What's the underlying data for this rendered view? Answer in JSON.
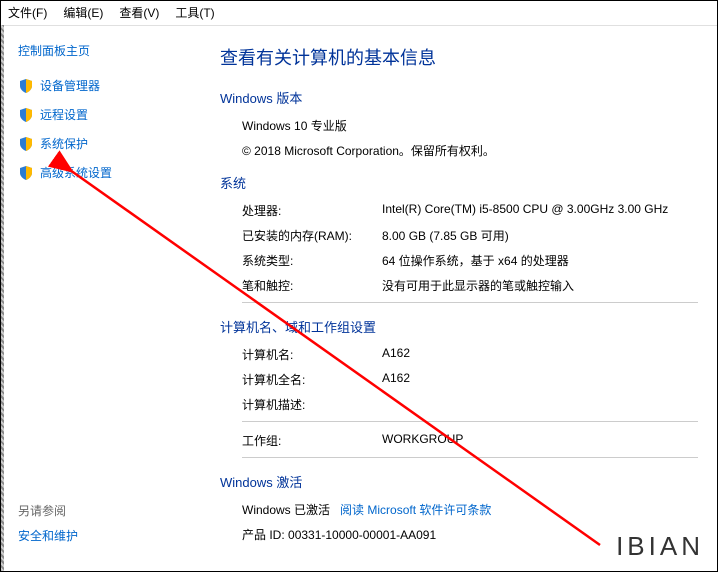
{
  "menu": {
    "file": "文件(F)",
    "edit": "编辑(E)",
    "view": "查看(V)",
    "tools": "工具(T)"
  },
  "sidebar": {
    "home": "控制面板主页",
    "items": [
      {
        "label": "设备管理器"
      },
      {
        "label": "远程设置"
      },
      {
        "label": "系统保护"
      },
      {
        "label": "高级系统设置"
      }
    ],
    "footer_label": "另请参阅",
    "footer_link": "安全和维护"
  },
  "main": {
    "title": "查看有关计算机的基本信息",
    "edition_section": {
      "title": "Windows 版本",
      "edition": "Windows 10 专业版",
      "copyright": "© 2018 Microsoft Corporation。保留所有权利。"
    },
    "system_section": {
      "title": "系统",
      "rows": [
        {
          "label": "处理器:",
          "value": "Intel(R) Core(TM) i5-8500 CPU @ 3.00GHz   3.00 GHz"
        },
        {
          "label": "已安装的内存(RAM):",
          "value": "8.00 GB (7.85 GB 可用)"
        },
        {
          "label": "系统类型:",
          "value": "64 位操作系统，基于 x64 的处理器"
        },
        {
          "label": "笔和触控:",
          "value": "没有可用于此显示器的笔或触控输入"
        }
      ]
    },
    "computer_section": {
      "title": "计算机名、域和工作组设置",
      "rows": [
        {
          "label": "计算机名:",
          "value": "A162"
        },
        {
          "label": "计算机全名:",
          "value": "A162"
        },
        {
          "label": "计算机描述:",
          "value": ""
        },
        {
          "label": "工作组:",
          "value": "WORKGROUP"
        }
      ]
    },
    "activation_section": {
      "title": "Windows 激活",
      "activated_prefix": "Windows 已激活",
      "license_link": "阅读 Microsoft 软件许可条款",
      "product_id_label": "产品 ID:",
      "product_id_value": "00331-10000-00001-AA091"
    }
  },
  "watermark": "IBIAN"
}
